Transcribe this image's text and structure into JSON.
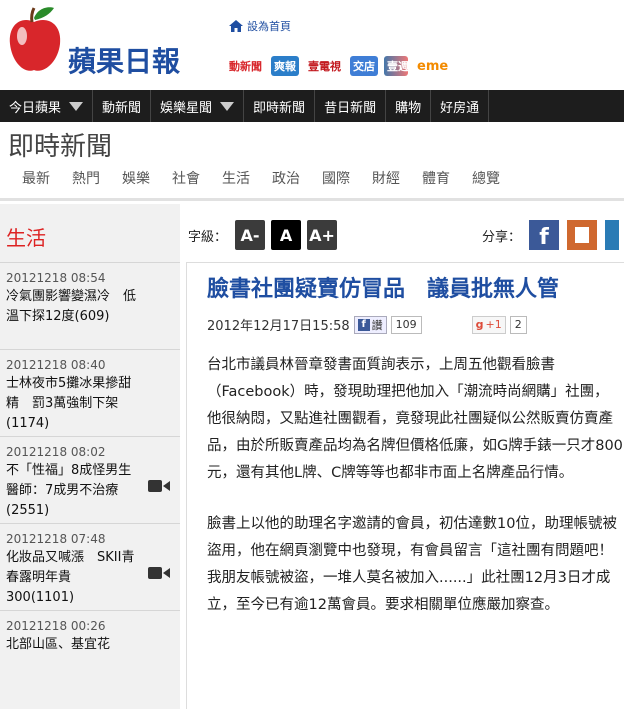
{
  "header": {
    "logo_text": "蘋果日報",
    "home_link": "設為首頁",
    "partners": [
      "動新聞",
      "爽報",
      "壹電視",
      "交店",
      "壹週",
      "eme"
    ]
  },
  "main_nav": {
    "items": [
      "今日蘋果",
      "動新聞",
      "娛樂星聞",
      "即時新聞",
      "昔日新聞",
      "購物",
      "好房通"
    ]
  },
  "section": {
    "title": "即時新聞",
    "tabs": [
      "最新",
      "熱門",
      "娛樂",
      "社會",
      "生活",
      "政治",
      "國際",
      "財經",
      "體育",
      "總覽"
    ]
  },
  "sidebar": {
    "title": "生活",
    "items": [
      {
        "date": "20121218 08:54",
        "title": "冷氣團影響變濕冷　低溫下探12度(609)",
        "video": false
      },
      {
        "date": "20121218 08:40",
        "title": "士林夜市5攤冰果摻甜精　罰3萬強制下架(1174)",
        "video": false
      },
      {
        "date": "20121218 08:02",
        "title": "不「性福」8成怪男生　醫師：7成男不治療(2551)",
        "video": true
      },
      {
        "date": "20121218 07:48",
        "title": "化妝品又喊漲　SKII青春露明年貴300(1101)",
        "video": true
      },
      {
        "date": "20121218 00:26",
        "title": "北部山區、基宜花",
        "video": false
      }
    ]
  },
  "toolbar": {
    "font_label": "字級：",
    "font_small": "A-",
    "font_normal": "A",
    "font_large": "A+",
    "share_label": "分享："
  },
  "article": {
    "headline": "臉書社團疑賣仿冒品　議員批無人管",
    "datetime": "2012年12月17日15:58",
    "fb_share_label": "讚",
    "fb_count": "109",
    "gplus_label": "+1",
    "gplus_count": "2",
    "paragraphs": [
      "台北市議員林晉章發書面質詢表示，上周五他觀看臉書（Facebook）時，發現助理把他加入「潮流時尚網購」社團，他很納悶，又點進社團觀看，竟發現此社團疑似公然販賣仿賣產品，由於所販賣產品均為名牌但價格低廉，如G牌手錶一只才800元，還有其他L牌、C牌等等也都非市面上名牌產品行情。",
      "臉書上以他的助理名字邀請的會員，初估達數10位，助理帳號被盜用，他在網頁瀏覽中也發現，有會員留言「這社團有問題吧！我朋友帳號被盜，一堆人莫名被加入......」此社團12月3日才成立，至今已有逾12萬會員。要求相關單位應嚴加察查。"
    ]
  },
  "colors": {
    "brand_blue": "#1f4ea1",
    "brand_red": "#d22222",
    "nav_bg": "#1d1d1d"
  }
}
